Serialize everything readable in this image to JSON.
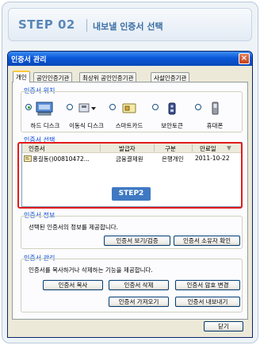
{
  "header": {
    "step": "STEP 02",
    "title": "내보낼 인증서 선택"
  },
  "dialog": {
    "title": "인증서 관리",
    "close": "×",
    "tabs": [
      {
        "label": "개인"
      },
      {
        "label": "공인인증기관"
      },
      {
        "label": "최상위 공인인증기관"
      },
      {
        "label": "사설인증기관"
      }
    ]
  },
  "location": {
    "heading": "인증서 위치",
    "items": [
      {
        "label": "하드 디스크",
        "icon": "hard-disk-icon"
      },
      {
        "label": "이동식 디스크",
        "icon": "removable-disk-icon"
      },
      {
        "label": "스마트카드",
        "icon": "smartcard-icon"
      },
      {
        "label": "보안토큰",
        "icon": "security-token-icon"
      },
      {
        "label": "휴대폰",
        "icon": "mobile-phone-icon"
      }
    ]
  },
  "selection": {
    "heading": "인증서 선택",
    "columns": [
      "인증서",
      "발급자",
      "구분",
      "만료일"
    ],
    "rows": [
      {
        "name": "홍길동()00810472...",
        "issuer": "금융결제원",
        "type": "은행개인",
        "expiry": "2011-10-22"
      }
    ],
    "badge": "STEP2"
  },
  "info": {
    "heading": "인증서 정보",
    "description": "선택된 인증서의 정보를 제공합니다.",
    "view_button": "인증서 보기/검증",
    "owner_button": "인증서 소유자 확인"
  },
  "manage": {
    "heading": "인증서 관리",
    "description": "인증서를 복사하거나 삭제하는 기능을 제공합니다.",
    "copy_button": "인증서 복사",
    "delete_button": "인증서 삭제",
    "password_button": "인증서 암호 변경",
    "import_button": "인증서 가져오기",
    "export_button": "인증서 내보내기"
  },
  "footer": {
    "close_button": "닫기"
  },
  "colors": {
    "accent": "#3f79c3",
    "highlight": "#e21b1b",
    "titlebar": "#0a58d8"
  }
}
